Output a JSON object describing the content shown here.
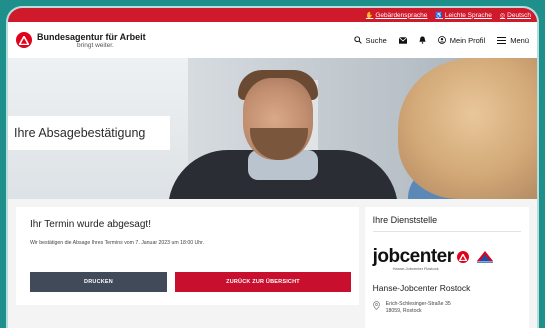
{
  "utility_bar": {
    "items": [
      {
        "label": "Gebärdensprache",
        "icon": "hand-sign-icon"
      },
      {
        "label": "Leichte Sprache",
        "icon": "easy-language-icon"
      },
      {
        "label": "Deutsch",
        "icon": "globe-icon"
      }
    ]
  },
  "header": {
    "logo_name": "Bundesagentur für Arbeit",
    "logo_tagline": "bringt weiter.",
    "search_label": "Suche",
    "profile_label": "Mein Profil",
    "menu_label": "Menü"
  },
  "hero": {
    "title": "Ihre Absagebestätigung"
  },
  "main_card": {
    "title": "Ihr Termin wurde abgesagt!",
    "text": "Wir bestätigen die Absage Ihres Termins vom 7. Januar 2023 um 18:00 Uhr.",
    "print_button": "DRUCKEN",
    "back_button": "ZURÜCK ZUR ÜBERSICHT"
  },
  "side_card": {
    "title": "Ihre Dienststelle",
    "logo_word": "jobcenter",
    "logo_sub": "Hanse-Jobcenter Rostock",
    "office_name": "Hanse-Jobcenter Rostock",
    "address_street": "Erich-Schlesinger-Straße 35",
    "address_city": "18059, Rostock"
  },
  "colors": {
    "accent_red": "#cf1a2b",
    "button_dark": "#404a58",
    "button_red": "#c8102e",
    "frame_teal": "#1f8f8c"
  }
}
